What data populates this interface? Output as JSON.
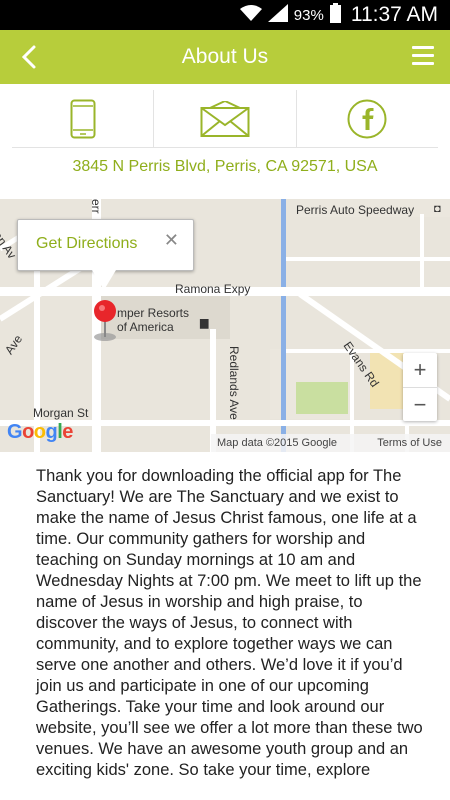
{
  "status_bar": {
    "battery": "93%",
    "time": "11:37 AM"
  },
  "header": {
    "title": "About Us"
  },
  "contact": {
    "address": "3845 N Perris Blvd, Perris, CA 92571, USA"
  },
  "map": {
    "callout_label": "Get Directions",
    "close_glyph": "✕",
    "labels": {
      "perris_auto_speedway": "Perris Auto Speedway",
      "ramona_expy": "Ramona Expy",
      "camper_resorts": "mper Resorts",
      "of_america": "of America",
      "redlands_ave": "Redlands Ave",
      "evans_rd": "Evans Rd",
      "morgan_st": "Morgan St",
      "ave_left": "Ave",
      "an_av": "an Av",
      "perris_frag": "err"
    },
    "zoom_in": "+",
    "zoom_out": "−",
    "attribution": "Map data ©2015 Google",
    "terms": "Terms of Use",
    "logo": "Google"
  },
  "about": {
    "body": "Thank you for downloading the official app for The Sanctuary! We are The Sanctuary and we exist to make the name of Jesus Christ famous, one life at a time. Our community gathers for worship and teaching on Sunday mornings at 10 am and Wednesday Nights at 7:00 pm. We meet to lift up the name of Jesus in worship and high praise, to discover the ways of Jesus, to connect with community, and to explore together ways we can serve one another and others. We’d love it if you’d join us and participate in one of our upcoming Gatherings. Take your time and look around our website, you’ll see we offer a lot more than these two venues. We have an awesome youth group and an exciting kids' zone. So take your time, explore"
  },
  "colors": {
    "accent": "#b7cd3b",
    "link": "#8fae1b"
  }
}
